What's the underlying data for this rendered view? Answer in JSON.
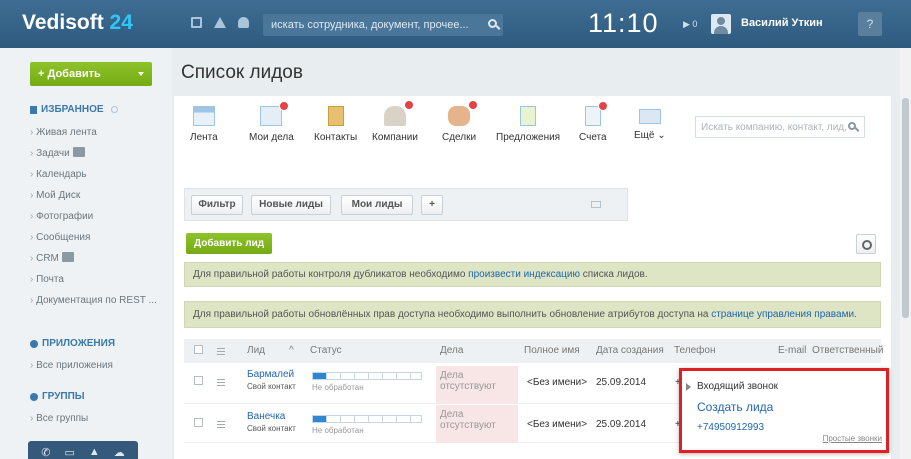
{
  "header": {
    "logo_main": "Vedisoft",
    "logo_num": "24",
    "search_placeholder": "искать сотрудника, документ, прочее...",
    "time": "11:10",
    "flag_count": "▶ 0",
    "user_name": "Василий Уткин",
    "help": "?"
  },
  "sidebar": {
    "add_label": "+ Добавить",
    "favorites_title": "ИЗБРАННОЕ",
    "favorites": [
      "Живая лента",
      "Задачи",
      "Календарь",
      "Мой Диск",
      "Фотографии",
      "Сообщения",
      "CRM",
      "Почта",
      "Документация по REST ..."
    ],
    "apps_title": "ПРИЛОЖЕНИЯ",
    "apps": [
      "Все приложения"
    ],
    "groups_title": "ГРУППЫ",
    "groups": [
      "Все группы"
    ]
  },
  "page_title": "Список лидов",
  "crm_tiles": [
    "Лента",
    "Мои дела",
    "Контакты",
    "Компании",
    "Сделки",
    "Предложения",
    "Счета",
    "Ещё ⌄"
  ],
  "crm_search_placeholder": "Искать компанию, контакт, лид, сдел",
  "filters": {
    "filter": "Фильтр",
    "new_leads": "Новые лиды",
    "my_leads": "Мои лиды",
    "plus": "+"
  },
  "add_lead": "Добавить лид",
  "notice1": {
    "before": "Для правильной работы контроля дубликатов необходимо ",
    "link": "произвести индексацию",
    "after": " списка лидов."
  },
  "notice2": {
    "before": "Для правильной работы обновлённых прав доступа необходимо выполнить обновление атрибутов доступа на ",
    "link": "странице управления правами."
  },
  "table": {
    "headers": {
      "lead": "Лид",
      "sort": "^",
      "status": "Статус",
      "deals": "Дела",
      "fullname": "Полное имя",
      "created": "Дата создания",
      "phone": "Телефон",
      "email": "E-mail",
      "responsible": "Ответственный"
    },
    "rows": [
      {
        "name": "Бармалей",
        "sub": "Свой контакт",
        "status": "Не обработан",
        "progress": 0.12,
        "deals": "Дела отсутствуют",
        "fullname": "<Без имени>",
        "created": "25.09.2014",
        "phone": "+7("
      },
      {
        "name": "Ванечка",
        "sub": "Свой контакт",
        "status": "Не обработан",
        "progress": 0.12,
        "deals": "Дела отсутствуют",
        "fullname": "<Без имени>",
        "created": "25.09.2014",
        "phone": "+7("
      }
    ]
  },
  "popup": {
    "title": "Входящий звонок",
    "create": "Создать лида",
    "phone": "+74950912993",
    "link": "Простые звонки"
  }
}
